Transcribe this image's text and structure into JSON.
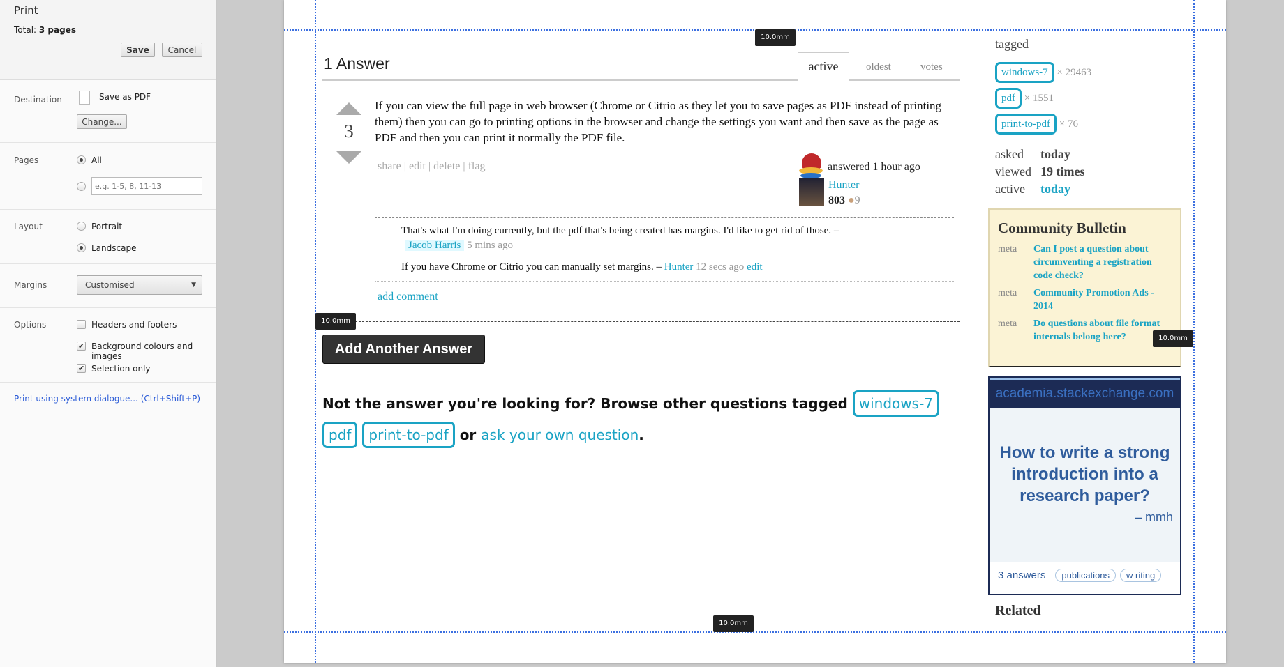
{
  "print": {
    "title": "Print",
    "total_label": "Total:",
    "total_value": "3 pages",
    "save": "Save",
    "cancel": "Cancel",
    "destination_label": "Destination",
    "destination_value": "Save as PDF",
    "change": "Change...",
    "pages_label": "Pages",
    "pages_all": "All",
    "pages_placeholder": "e.g. 1-5, 8, 11-13",
    "pages_selected": "All",
    "layout_label": "Layout",
    "portrait": "Portrait",
    "landscape": "Landscape",
    "layout_selected": "Landscape",
    "margins_label": "Margins",
    "margins_value": "Customised",
    "options_label": "Options",
    "options": [
      {
        "label": "Headers and footers",
        "checked": false
      },
      {
        "label": "Background colours and images",
        "checked": true
      },
      {
        "label": "Selection only",
        "checked": true
      }
    ],
    "system_dialog": "Print using system dialogue... (Ctrl+Shift+P)"
  },
  "margin_labels": [
    "10.0mm",
    "10.0mm",
    "10.0mm",
    "10.0mm"
  ],
  "answers": {
    "title": "1 Answer",
    "tabs": [
      {
        "label": "active",
        "selected": true
      },
      {
        "label": "oldest"
      },
      {
        "label": "votes"
      }
    ],
    "votes": "3",
    "body": "If you can view the full page in web browser (Chrome or Citrio as they let you to save pages as PDF instead of printing them) then you can go to printing options in the browser and change the settings you want and then save as the page as PDF and then you can print it normally the PDF file.",
    "actions": [
      "share",
      "edit",
      "delete",
      "flag"
    ],
    "answered": "answered 1 hour ago",
    "user": "Hunter",
    "rep": "803",
    "bronze": "9",
    "comments": [
      {
        "text": "That's what I'm doing currently, but the pdf that's being created has margins. I'd like to get rid of those. –",
        "user": "Jacob Harris",
        "time": "5 mins ago"
      },
      {
        "text": "If you have Chrome or Citrio you can manually set margins. –",
        "user": "Hunter",
        "time": "12 secs ago",
        "edit": "edit"
      }
    ],
    "add_comment": "add comment",
    "add_answer": "Add Another Answer",
    "browse_prefix": "Not the answer you're looking for? Browse other questions tagged",
    "browse_tags": [
      "windows-7",
      "pdf",
      "print-to-pdf"
    ],
    "browse_or": "or",
    "ask": "ask your own question",
    "period": "."
  },
  "sidebar": {
    "tagged": "tagged",
    "tags": [
      {
        "name": "windows-7",
        "count": "× 29463"
      },
      {
        "name": "pdf",
        "count": "× 1551"
      },
      {
        "name": "print-to-pdf",
        "count": "× 76"
      }
    ],
    "stats": [
      {
        "label": "asked",
        "value": "today"
      },
      {
        "label": "viewed",
        "value": "19 times"
      },
      {
        "label": "active",
        "value": "today"
      }
    ],
    "bulletin": {
      "title": "Community Bulletin",
      "items": [
        {
          "src": "meta",
          "text": "Can I post a question about circumventing a registration code check?"
        },
        {
          "src": "meta",
          "text": "Community Promotion Ads - 2014"
        },
        {
          "src": "meta",
          "text": "Do questions about file format internals belong here?"
        }
      ]
    },
    "ad": {
      "site": "academia.stackexchange.com",
      "question": "How to write a strong introduction into a research paper?",
      "author": "– mmh",
      "answers": "3 answers",
      "tags": [
        "publications",
        "w riting"
      ]
    },
    "related": "Related"
  },
  "colors": {
    "link": "#1aa3c4",
    "bulletin_bg": "#fbf3d5",
    "ad_header": "#1c2b55"
  }
}
